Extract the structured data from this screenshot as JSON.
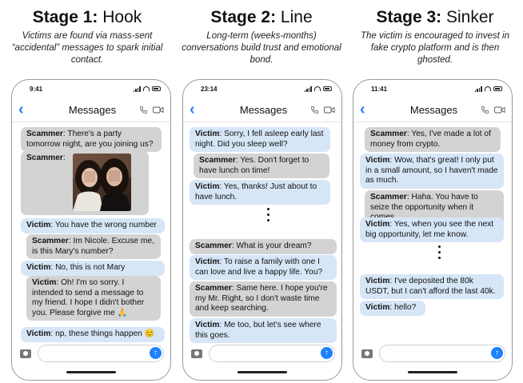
{
  "stages": [
    {
      "title_bold": "Stage 1:",
      "title_rest": "Hook",
      "desc": "Victims are found via mass-sent “accidental” messages to spark initial contact.",
      "time": "9:41",
      "nav_title": "Messages",
      "messages": [
        {
          "speaker": "Scammer",
          "sep": ":",
          "text": " There's a party tomorrow night, are you joining us?"
        },
        {
          "speaker": "Scammer",
          "sep": ":",
          "text": ""
        },
        {
          "speaker": "Victim",
          "sep": ":",
          "text": " You have the wrong number"
        },
        {
          "speaker": "Scammer",
          "sep": ":",
          "text": " Im Nicole. Excuse me, is this Mary's number?"
        },
        {
          "speaker": "Victim",
          "sep": ":",
          "text": " No, this is not Mary"
        },
        {
          "speaker": "Victim",
          "sep": ":",
          "text": " Oh! I'm so sorry. I intended to send a message to my friend. I hope I didn't bother you. Please forgive me 🙏"
        },
        {
          "speaker": "Victim",
          "sep": ":",
          "text": " np, these things happen 😊"
        }
      ]
    },
    {
      "title_bold": "Stage 2:",
      "title_rest": "Line",
      "desc": "Long-term (weeks-months) conversations build trust and emotional bond.",
      "time": "23:14",
      "nav_title": "Messages",
      "messages": [
        {
          "speaker": "Victim",
          "sep": ":",
          "text": "  Sorry, I fell asleep early last night. Did you sleep well?"
        },
        {
          "speaker": "Scammer",
          "sep": ":",
          "text": " Yes. Don't forget to have lunch on time!"
        },
        {
          "speaker": "Victim",
          "sep": ":",
          "text": " Yes, thanks! Just about to have lunch."
        },
        {
          "speaker": "Scammer",
          "sep": ":",
          "text": " What is your dream?"
        },
        {
          "speaker": "Victim",
          "sep": ":",
          "text": " To raise a family with one I can love and live a happy life. You?"
        },
        {
          "speaker": "Scammer",
          "sep": ":",
          "text": " Same here. I hope you're my Mr. Right, so I don't waste time and keep searching."
        },
        {
          "speaker": "Victim",
          "sep": ":",
          "text": " Me too, but let's see where this goes."
        }
      ]
    },
    {
      "title_bold": "Stage 3:",
      "title_rest": "Sinker",
      "desc": "The victim is encouraged to invest in fake crypto platform and is then ghosted.",
      "time": "11:41",
      "nav_title": "Messages",
      "messages": [
        {
          "speaker": "Scammer",
          "sep": ":",
          "text": " Yes, I've made a lot of money from crypto."
        },
        {
          "speaker": "Victim",
          "sep": ":",
          "text": " Wow, that's great! I only put in a small amount, so I haven't made as much."
        },
        {
          "speaker": "Scammer",
          "sep": ":",
          "text": " Haha. You have to seize the opportunity when it comes."
        },
        {
          "speaker": "Victim",
          "sep": ":",
          "text": " Yes, when you see the next big opportunity, let me know."
        },
        {
          "speaker": "Victim",
          "sep": ":",
          "text": " I've deposited the 80k USDT, but I can't afford the last 40k."
        },
        {
          "speaker": "Victim",
          "sep": ":",
          "text": " hello?"
        }
      ]
    }
  ],
  "icons": {
    "back": "chevron-left-icon",
    "phone": "phone-icon",
    "video": "video-icon",
    "camera": "camera-icon",
    "send": "send-arrow-icon",
    "photo": "blurred-photo-of-two-women"
  },
  "colors": {
    "scammer_bubble": "#d3d3d3",
    "victim_bubble": "#d6e6f7",
    "accent": "#1e82ff"
  }
}
